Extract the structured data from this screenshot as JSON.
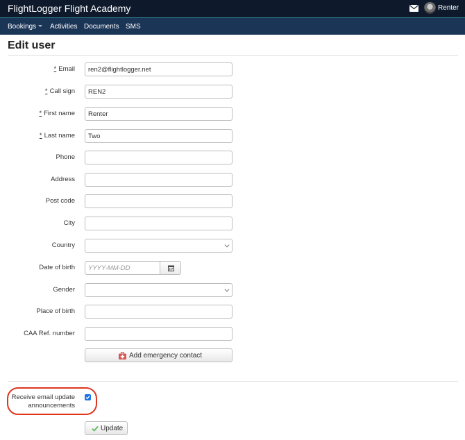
{
  "header": {
    "app_title": "FlightLogger Flight Academy",
    "user_name": "Renter",
    "icons": {
      "mail": "envelope-icon",
      "avatar": "user-avatar"
    }
  },
  "nav": {
    "items": [
      {
        "label": "Bookings",
        "has_dropdown": true
      },
      {
        "label": "Activities"
      },
      {
        "label": "Documents"
      },
      {
        "label": "SMS"
      }
    ]
  },
  "page": {
    "title": "Edit user"
  },
  "form": {
    "required_marker": "*",
    "email": {
      "label": "Email",
      "value": "ren2@flightlogger.net",
      "required": true
    },
    "call_sign": {
      "label": "Call sign",
      "value": "REN2",
      "required": true
    },
    "first_name": {
      "label": "First name",
      "value": "Renter",
      "required": true
    },
    "last_name": {
      "label": "Last name",
      "value": "Two",
      "required": true
    },
    "phone": {
      "label": "Phone",
      "value": ""
    },
    "address": {
      "label": "Address",
      "value": ""
    },
    "post_code": {
      "label": "Post code",
      "value": ""
    },
    "city": {
      "label": "City",
      "value": ""
    },
    "country": {
      "label": "Country",
      "value": ""
    },
    "date_of_birth": {
      "label": "Date of birth",
      "value": "",
      "placeholder": "YYYY-MM-DD"
    },
    "gender": {
      "label": "Gender",
      "value": ""
    },
    "place_of_birth": {
      "label": "Place of birth",
      "value": ""
    },
    "caa_ref": {
      "label": "CAA Ref. number",
      "value": ""
    },
    "emergency_button": "Add emergency contact",
    "email_updates": {
      "label_line1": "Receive email update",
      "label_line2": "announcements",
      "checked": true
    },
    "update_button": "Update"
  },
  "colors": {
    "topbar": "#0e1a2c",
    "navbar": "#1b3556",
    "checkbox": "#1a73e8",
    "highlight": "#e0341e",
    "emergency_icon": "#d9534f",
    "update_check": "#5cb85c"
  }
}
